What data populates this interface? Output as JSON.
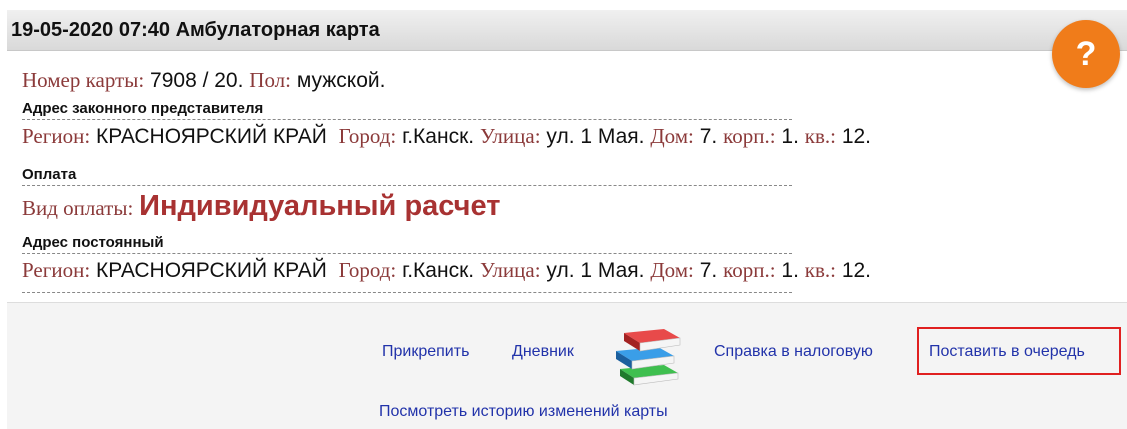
{
  "header": {
    "title": "19-05-2020 07:40 Амбулаторная карта"
  },
  "help": {
    "label": "?"
  },
  "card_info": {
    "card_number_label": "Номер карты:",
    "card_number_value": "7908 / 20.",
    "sex_label": "Пол:",
    "sex_value": "мужской."
  },
  "sections": {
    "legal_address": {
      "title": "Адрес законного представителя",
      "region_label": "Регион:",
      "region_value": "КРАСНОЯРСКИЙ КРАЙ",
      "city_label": "Город:",
      "city_value": "г.Канск.",
      "street_label": "Улица:",
      "street_value": "ул. 1 Мая.",
      "house_label": "Дом:",
      "house_value": "7.",
      "building_label": "корп.:",
      "building_value": "1.",
      "apt_label": "кв.:",
      "apt_value": "12."
    },
    "payment": {
      "title": "Оплата",
      "type_label": "Вид оплаты:",
      "type_value": "Индивидуальный расчет"
    },
    "permanent_address": {
      "title": "Адрес постоянный",
      "region_label": "Регион:",
      "region_value": "КРАСНОЯРСКИЙ КРАЙ",
      "city_label": "Город:",
      "city_value": "г.Канск.",
      "street_label": "Улица:",
      "street_value": "ул. 1 Мая.",
      "house_label": "Дом:",
      "house_value": "7.",
      "building_label": "корп.:",
      "building_value": "1.",
      "apt_label": "кв.:",
      "apt_value": "12."
    }
  },
  "actions": {
    "attach": "Прикрепить",
    "diary": "Дневник",
    "tax_certificate": "Справка в налоговую",
    "queue": "Поставить в очередь",
    "history": "Посмотреть историю изменений карты"
  },
  "colors": {
    "label": "#8b3a3a",
    "link": "#2233aa",
    "help": "#f07c1a",
    "highlight": "#e02020"
  }
}
